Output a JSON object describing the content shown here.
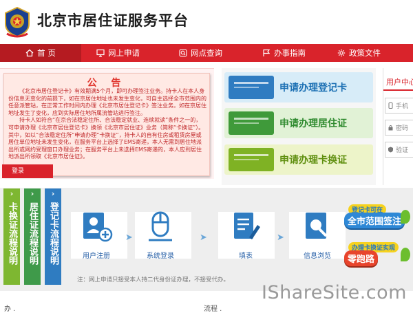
{
  "header": {
    "title": "北京市居住证服务平台"
  },
  "nav": {
    "items": [
      {
        "label": "首 页",
        "icon": "home-icon"
      },
      {
        "label": "网上申请",
        "icon": "monitor-icon"
      },
      {
        "label": "网点查询",
        "icon": "search-icon"
      },
      {
        "label": "办事指南",
        "icon": "flag-icon"
      },
      {
        "label": "政策文件",
        "icon": "gear-icon"
      }
    ]
  },
  "notice": {
    "title": "公 告",
    "paragraphs": [
      "《北京市居住登记卡》有效期满5个月，即可办理签注业务。持卡人在本人身份信息无变化的前提下，如在京居住地址也未发生变化，可自主选择全市范围内的任意派管站，在正常工作时间内办理《北京市居住登记卡》签注业务。如在京居住地址发生了变化，应到实际居住地所属流管站进行签注。",
      "持卡人如符合“在京合法稳定住所、合法稳定就业、连续就读”条件之一的，可申请办理《北京市居住登记卡》换领《北京市居住证》业务（简称“卡换证”）。其中，如以“合法稳定住所”申请办理“卡换证”，持卡人的自有住房或租赁房屋或居住单位地址未发生变化，在服务平台上选择了EMS寄递，本人无需到居住地派出所或网约受理窗口办理业务；在服务平台上未选择EMS寄递的，本人应到居住地派出所领取《北京市居住证》。"
    ]
  },
  "services": [
    {
      "label": "申请办理登记卡"
    },
    {
      "label": "申请办理居住证"
    },
    {
      "label": "申请办理卡换证"
    }
  ],
  "login": {
    "title": "用户中心",
    "phone_placeholder": "手机",
    "password_placeholder": "密码",
    "code_placeholder": "验证",
    "button": "登录"
  },
  "process": {
    "tabs": [
      {
        "label": "卡换证流程说明"
      },
      {
        "label": "居住证流程说明"
      },
      {
        "label": "登记卡流程说明"
      }
    ],
    "steps": [
      {
        "label": "用户注册",
        "icon": "user-add-icon"
      },
      {
        "label": "系统登录",
        "icon": "mouse-icon"
      },
      {
        "label": "填表",
        "icon": "form-edit-icon"
      },
      {
        "label": "信息浏览",
        "icon": "document-search-icon"
      }
    ],
    "note": "注：网上申请只接受本人持二代身份证办理，不接受代办。"
  },
  "promos": [
    {
      "line1": "登记卡可在",
      "line2": "全市范围签注"
    },
    {
      "line1": "办理卡换证实现",
      "line2": "零跑路"
    }
  ],
  "bottom": {
    "left": "办  .",
    "mid": "流程  ."
  },
  "watermark": "IShareSite.com",
  "colors": {
    "primary": "#d9232b",
    "blue": "#2f7cc1",
    "green": "#3f9a4a",
    "lime": "#7eb731"
  }
}
